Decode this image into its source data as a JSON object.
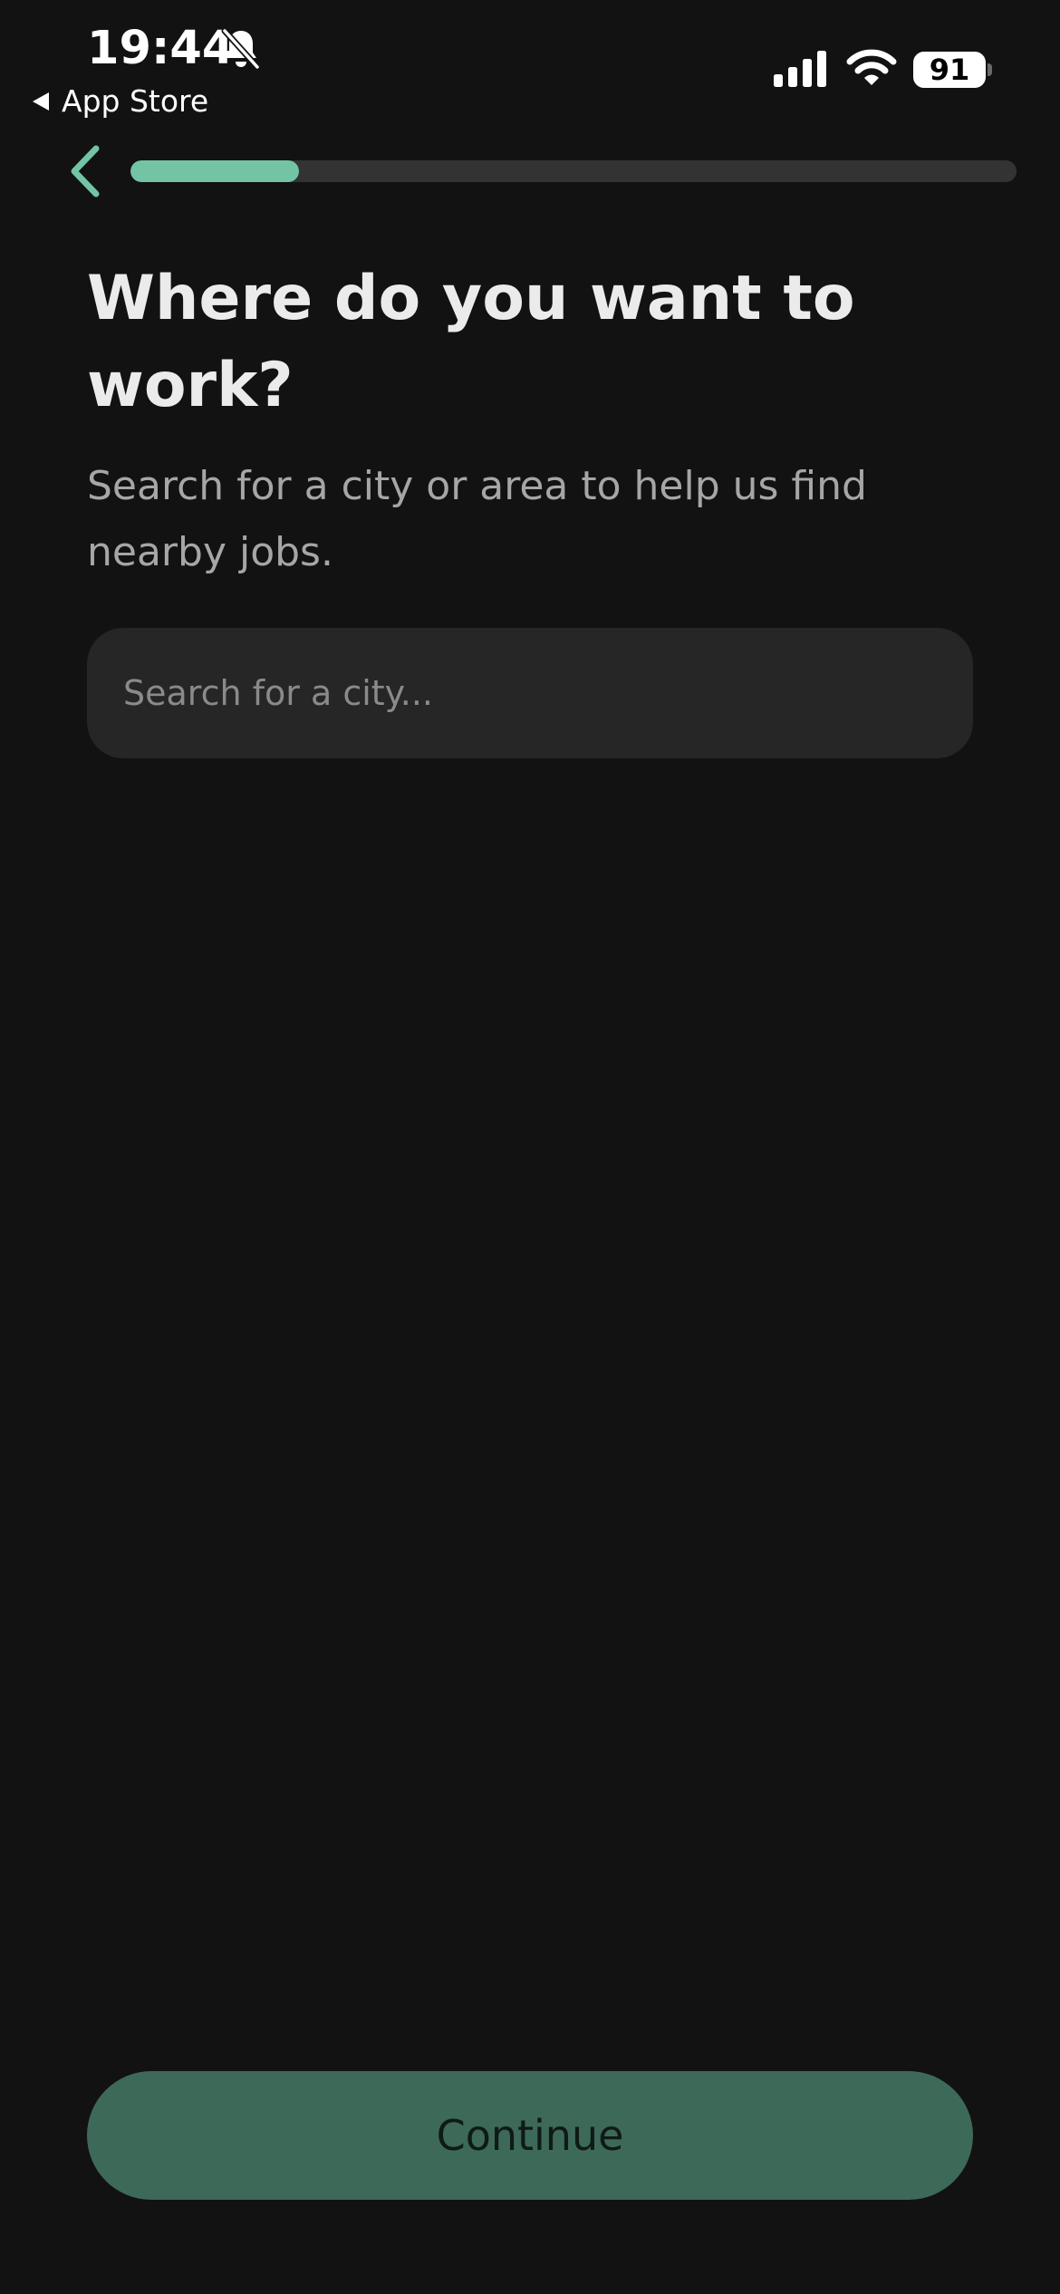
{
  "status_bar": {
    "time": "19:44",
    "back_app_label": "App Store",
    "battery": "91",
    "icons": [
      "bell-slash-icon",
      "cellular-signal-icon",
      "wifi-icon",
      "battery-icon"
    ]
  },
  "nav": {
    "back_icon": "chevron-left-icon",
    "progress_fraction": 0.19
  },
  "content": {
    "title": "Where do you want to work?",
    "subtitle": "Search for a city or area to help us find nearby jobs.",
    "search_placeholder": "Search for a city...",
    "search_value": ""
  },
  "footer": {
    "continue_label": "Continue"
  },
  "colors": {
    "background": "#121212",
    "accent": "#72c4a4",
    "button": "#3d6959",
    "input_bg": "#262626",
    "progress_track": "#333333"
  }
}
